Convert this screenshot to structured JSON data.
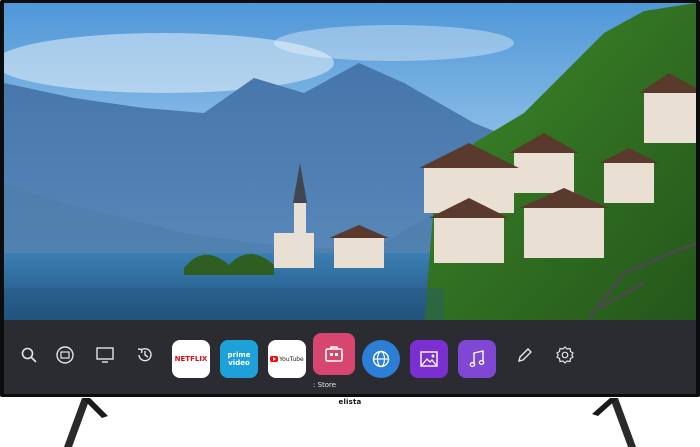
{
  "brand": {
    "name": "elista"
  },
  "launcher": {
    "left_icons": [
      "search-icon",
      "input-source-icon",
      "tv-icon",
      "recent-icon"
    ],
    "apps": [
      {
        "name": "netflix",
        "label": "NETFLIX",
        "color": "#e50914",
        "bg": "#ffffff"
      },
      {
        "name": "prime-video",
        "label_line1": "prime",
        "label_line2": "video",
        "bg": "#1ea1d8"
      },
      {
        "name": "youtube",
        "label": "YouTube",
        "bg": "#ffffff",
        "accent": "#ff0000"
      },
      {
        "name": "store",
        "bg": "#d7466f",
        "focused": true
      },
      {
        "name": "web-browser",
        "bg": "#2b7fd6"
      },
      {
        "name": "gallery",
        "bg": "#7a2fd0"
      },
      {
        "name": "music",
        "bg": "#7f47d4"
      }
    ],
    "right_icons": [
      "edit-icon",
      "settings-icon"
    ],
    "focused_label": ": Store"
  }
}
